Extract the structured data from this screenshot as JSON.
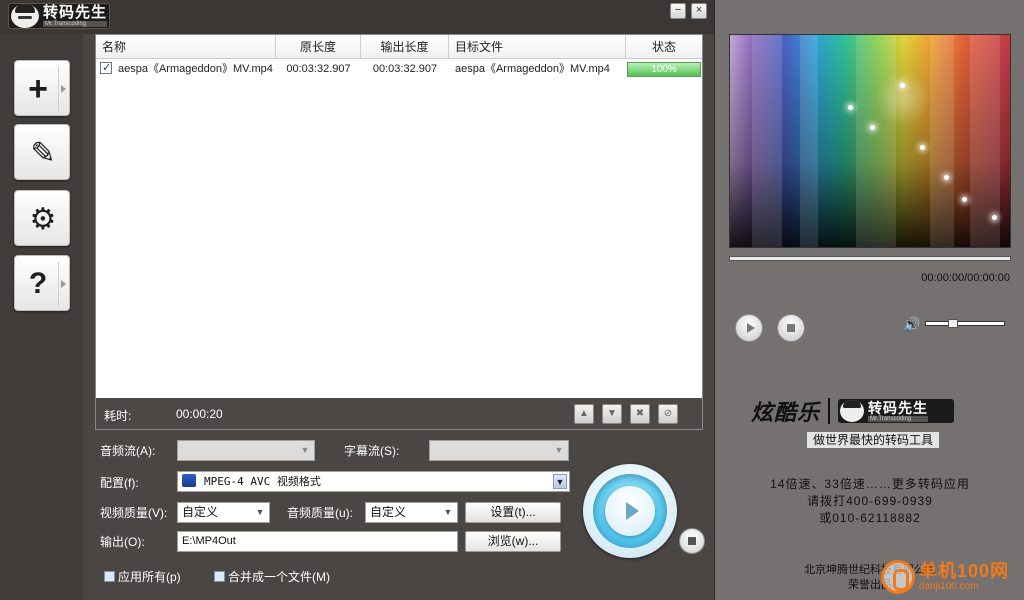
{
  "app": {
    "logo_cn": "转码先生",
    "logo_en": "Mr.Transcoding",
    "minimize": "−",
    "close": "×"
  },
  "sidebar": {
    "add": "+",
    "edit": "✎",
    "settings": "⚙",
    "help": "?"
  },
  "filelist": {
    "columns": [
      "名称",
      "原长度",
      "输出长度",
      "目标文件",
      "状态"
    ],
    "rows": [
      {
        "checked": true,
        "name": "aespa《Armageddon》MV.mp4",
        "source_length": "00:03:32.907",
        "output_length": "00:03:32.907",
        "target_file": "aespa《Armageddon》MV.mp4",
        "status": "100%",
        "progress": 1.0
      }
    ],
    "elapsed_label": "耗时:",
    "elapsed_value": "00:00:20"
  },
  "form": {
    "audio_stream_label": "音频流(A):",
    "subtitle_stream_label": "字幕流(S):",
    "profile_label": "配置(f):",
    "profile_value": "MPEG-4 AVC 视频格式",
    "video_quality_label": "视频质量(V):",
    "video_quality_value": "自定义",
    "audio_quality_label": "音频质量(u):",
    "audio_quality_value": "自定义",
    "settings_button": "设置(t)...",
    "output_label": "输出(O):",
    "output_value": "E:\\MP4Out",
    "browse_button": "浏览(w)...",
    "apply_all": "应用所有(p)",
    "merge_one": "合并成一个文件(M)"
  },
  "player": {
    "time": "00:00:00/00:00:00"
  },
  "promo": {
    "brand": "炫酷乐",
    "logo_cn": "转码先生",
    "logo_en": "Mr.Transcoding",
    "slogan": "做世界最快的转码工具",
    "line1": "14倍速、33倍速……更多转码应用",
    "line2": "请拨打400-699-0939",
    "line3": "或010-62118882",
    "company1": "北京坤腾世纪科技有限公司",
    "company2": "荣誉出品"
  },
  "watermark": {
    "title": "单机100网",
    "url": "danji100.com"
  },
  "colors": {
    "accent": "#2aa8d8",
    "progress": "#52c152",
    "watermark": "#f07a1c"
  }
}
